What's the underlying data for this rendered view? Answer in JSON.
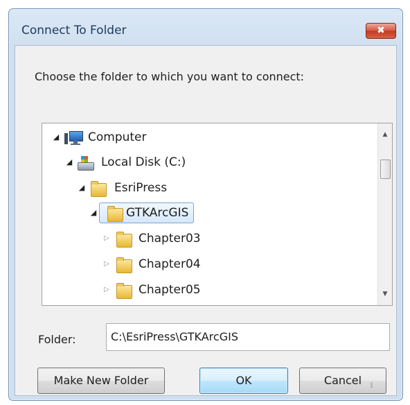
{
  "window": {
    "title": "Connect To Folder",
    "close_glyph": "✖"
  },
  "prompt": "Choose the folder to which you want to connect:",
  "tree": {
    "items": [
      {
        "label": "Computer",
        "icon": "computer-icon",
        "expanded": true
      },
      {
        "label": "Local Disk (C:)",
        "icon": "local-disk-icon",
        "expanded": true
      },
      {
        "label": "EsriPress",
        "icon": "folder-icon",
        "expanded": true
      },
      {
        "label": "GTKArcGIS",
        "icon": "folder-icon",
        "expanded": true,
        "selected": true
      },
      {
        "label": "Chapter03",
        "icon": "folder-icon",
        "expanded": false
      },
      {
        "label": "Chapter04",
        "icon": "folder-icon",
        "expanded": false
      },
      {
        "label": "Chapter05",
        "icon": "folder-icon",
        "expanded": false
      }
    ],
    "scroll_up_glyph": "▲",
    "scroll_down_glyph": "▼"
  },
  "folder": {
    "label": "Folder:",
    "value": "C:\\EsriPress\\GTKArcGIS"
  },
  "buttons": {
    "make_new_folder": "Make New Folder",
    "ok": "OK",
    "cancel": "Cancel"
  },
  "colors": {
    "title_bar": "#dbe8f6",
    "close_button": "#c4381f",
    "selection_border": "#7da2ce",
    "ok_button": "#bee6fd"
  }
}
